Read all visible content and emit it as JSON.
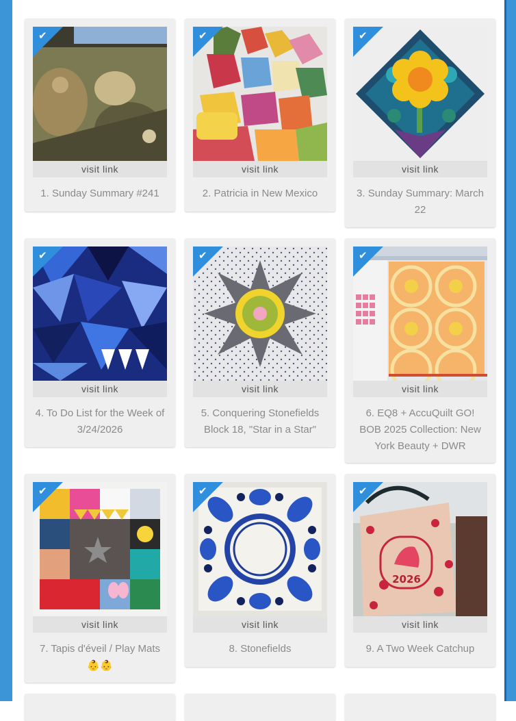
{
  "cards": [
    {
      "link_label": "visit link",
      "title": "1. Sunday Summary #241",
      "checked": true
    },
    {
      "link_label": "visit link",
      "title": "2. Patricia in New Mexico",
      "checked": true
    },
    {
      "link_label": "visit link",
      "title": "3. Sunday Summary: March 22",
      "checked": true
    },
    {
      "link_label": "visit link",
      "title": "4. To Do List for the Week of 3/24/2026",
      "checked": true
    },
    {
      "link_label": "visit link",
      "title": "5. Conquering Stonefields Block 18, \"Star in a Star\"",
      "checked": true
    },
    {
      "link_label": "visit link",
      "title": "6. EQ8 + AccuQuilt GO! BOB 2025 Collection: New York Beauty + DWR",
      "checked": true
    },
    {
      "link_label": "visit link",
      "title": "7. Tapis d'éveil / Play Mats",
      "title_emoji": "👶👶",
      "checked": true
    },
    {
      "link_label": "visit link",
      "title": "8. Stonefields",
      "checked": true
    },
    {
      "link_label": "visit link",
      "title": "9. A Two Week Catchup",
      "checked": true
    }
  ],
  "image_text": {
    "year_2026": "2026"
  },
  "icons": {
    "check": "checkmark-icon"
  },
  "colors": {
    "frame": "#3b95d6",
    "badge": "#2f8fdc",
    "card": "#efefef"
  }
}
